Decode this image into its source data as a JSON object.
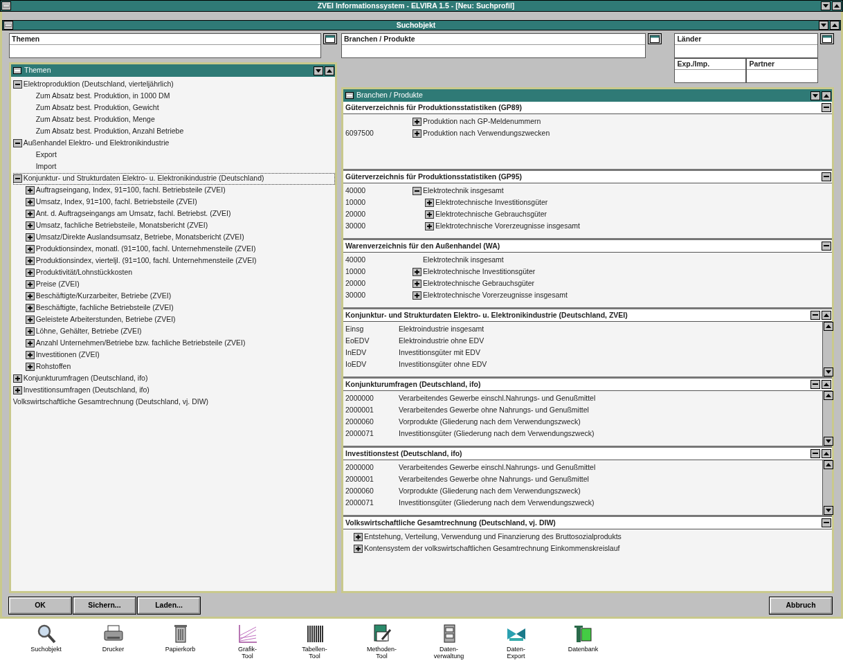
{
  "window": {
    "title": "ZVEI Informationssystem - ELVIRA 1.5 - [Neu: Suchprofil]"
  },
  "subwindow": {
    "title": "Suchobjekt"
  },
  "fields": {
    "themen": {
      "label": "Themen"
    },
    "branchen": {
      "label": "Branchen / Produkte"
    },
    "laender": {
      "label": "Länder"
    },
    "exp_imp": {
      "label": "Exp./Imp."
    },
    "partner": {
      "label": "Partner"
    }
  },
  "themen_panel": {
    "title": "Themen",
    "tree": [
      {
        "label": "Elektroproduktion (Deutschland, vierteljährlich)",
        "expanded": true,
        "selected": false,
        "children": [
          {
            "label": "Zum Absatz best. Produktion, in 1000 DM",
            "selected": false
          },
          {
            "label": "Zum Absatz best. Produktion, Gewicht",
            "selected": false
          },
          {
            "label": "Zum Absatz best. Produktion, Menge",
            "selected": false
          },
          {
            "label": "Zum Absatz best. Produktion, Anzahl Betriebe",
            "selected": false
          }
        ]
      },
      {
        "label": "Außenhandel Elektro- und Elektronikindustrie",
        "expanded": true,
        "selected": false,
        "children": [
          {
            "label": "Export",
            "selected": false
          },
          {
            "label": "Import",
            "selected": false
          }
        ]
      },
      {
        "label": "Konjunktur- und Strukturdaten Elektro- u. Elektronikindustrie (Deutschland)",
        "expanded": true,
        "selected": true,
        "children": [
          {
            "label": "Auftragseingang, Index, 91=100, fachl. Betriebsteile (ZVEI)",
            "expanded": false,
            "selected": false
          },
          {
            "label": "Umsatz, Index, 91=100, fachl. Betriebsteile (ZVEI)",
            "expanded": false,
            "selected": false
          },
          {
            "label": "Ant. d. Auftragseingangs am Umsatz, fachl. Betriebst. (ZVEI)",
            "expanded": false,
            "selected": false
          },
          {
            "label": "Umsatz, fachliche Betriebsteile, Monatsbericht (ZVEI)",
            "expanded": false,
            "selected": false
          },
          {
            "label": "Umsatz/Direkte Auslandsumsatz, Betriebe, Monatsbericht (ZVEI)",
            "expanded": false,
            "selected": false
          },
          {
            "label": "Produktionsindex, monatl. (91=100, fachl. Unternehmensteile (ZVEI)",
            "expanded": false,
            "selected": false
          },
          {
            "label": "Produktionsindex, vierteljl. (91=100, fachl. Unternehmensteile (ZVEI)",
            "expanded": false,
            "selected": false
          },
          {
            "label": "Produktivität/Lohnstückkosten",
            "expanded": false,
            "selected": false
          },
          {
            "label": "Preise (ZVEI)",
            "expanded": false,
            "selected": false
          },
          {
            "label": "Beschäftigte/Kurzarbeiter, Betriebe (ZVEI)",
            "expanded": false,
            "selected": false
          },
          {
            "label": "Beschäftigte, fachliche Betriebsteile (ZVEI)",
            "expanded": false,
            "selected": false
          },
          {
            "label": "Geleistete Arbeiterstunden, Betriebe (ZVEI)",
            "expanded": false,
            "selected": false
          },
          {
            "label": "Löhne, Gehälter, Betriebe (ZVEI)",
            "expanded": false,
            "selected": false
          },
          {
            "label": "Anzahl Unternehmen/Betriebe bzw. fachliche Betriebsteile (ZVEI)",
            "expanded": false,
            "selected": false
          },
          {
            "label": "Investitionen (ZVEI)",
            "expanded": false,
            "selected": false
          },
          {
            "label": "Rohstoffen",
            "expanded": false,
            "selected": false
          }
        ]
      },
      {
        "label": "Konjunkturumfragen (Deutschland, ifo)",
        "expanded": false,
        "selected": false
      },
      {
        "label": "Investitionsumfragen (Deutschland, ifo)",
        "expanded": false,
        "selected": false
      },
      {
        "label": "Volkswirtschaftliche Gesamtrechnung (Deutschland, vj. DIW)",
        "selected": false
      }
    ]
  },
  "branchen_panel": {
    "title": "Branchen / Produkte",
    "sections": [
      {
        "title": "Güterverzeichnis für Produktionsstatistiken (GP89)",
        "kind": "coded-tree",
        "rows": [
          {
            "text": "Produktion nach GP-Meldenummern",
            "expanded": false
          },
          {
            "code": "6097500",
            "text": "Produktion nach Verwendungszwecken",
            "expanded": false
          }
        ]
      },
      {
        "title": "Güterverzeichnis für Produktionsstatistiken (GP95)",
        "kind": "coded-tree",
        "rows": [
          {
            "code": "40000",
            "text": "Elektrotechnik insgesamt",
            "expanded": true,
            "children": [
              {
                "code": "10000",
                "text": "Elektrotechnische Investitionsgüter",
                "expanded": false
              },
              {
                "code": "20000",
                "text": "Elektrotechnische Gebrauchsgüter",
                "expanded": false
              },
              {
                "code": "30000",
                "text": "Elektrotechnische Vorerzeugnisse insgesamt",
                "expanded": false
              }
            ]
          }
        ]
      },
      {
        "title": "Warenverzeichnis für den Außenhandel (WA)",
        "kind": "coded-tree",
        "rows": [
          {
            "code": "40000",
            "text": "Elektrotechnik insgesamt"
          },
          {
            "code": "10000",
            "text": "Elektrotechnische Investitionsgüter",
            "expanded": false
          },
          {
            "code": "20000",
            "text": "Elektrotechnische Gebrauchsgüter",
            "expanded": false
          },
          {
            "code": "30000",
            "text": "Elektrotechnische Vorerzeugnisse insgesamt",
            "expanded": false
          }
        ]
      },
      {
        "title": "Konjunktur- und Strukturdaten Elektro- u. Elektronikindustrie (Deutschland, ZVEI)",
        "kind": "scrolled",
        "rows": [
          {
            "code": "Einsg",
            "text": "Elektroindustrie insgesamt"
          },
          {
            "code": "EoEDV",
            "text": "Elektroindustrie ohne EDV"
          },
          {
            "code": "InEDV",
            "text": "Investitionsgüter mit EDV"
          },
          {
            "code": "IoEDV",
            "text": "Investitionsgüter ohne EDV"
          }
        ]
      },
      {
        "title": "Konjunkturumfragen (Deutschland, ifo)",
        "kind": "scrolled",
        "rows": [
          {
            "code": "2000000",
            "text": "Verarbeitendes Gewerbe einschl.Nahrungs- und Genußmittel"
          },
          {
            "code": "2000001",
            "text": "Verarbeitendes Gewerbe ohne Nahrungs- und Genußmittel"
          },
          {
            "code": "2000060",
            "text": "Vorprodukte (Gliederung nach dem Verwendungszweck)"
          },
          {
            "code": "2000071",
            "text": "Investitionsgüter (Gliederung nach dem Verwendungszweck)"
          }
        ]
      },
      {
        "title": "Investitionstest (Deutschland, ifo)",
        "kind": "scrolled",
        "rows": [
          {
            "code": "2000000",
            "text": "Verarbeitendes Gewerbe einschl.Nahrungs- und Genußmittel"
          },
          {
            "code": "2000001",
            "text": "Verarbeitendes Gewerbe ohne Nahrungs- und Genußmittel"
          },
          {
            "code": "2000060",
            "text": "Vorprodukte (Gliederung nach dem Verwendungszweck)"
          },
          {
            "code": "2000071",
            "text": "Investitionsgüter (Gliederung nach dem Verwendungszweck)"
          }
        ]
      },
      {
        "title": "Volkswirtschaftliche Gesamtrechnung (Deutschland, vj. DIW)",
        "kind": "tree",
        "rows": [
          {
            "text": "Entstehung, Verteilung, Verwendung und Finanzierung des Bruttosozialprodukts",
            "expanded": false
          },
          {
            "text": "Kontensystem der volkswirtschaftlichen Gesamtrechnung Einkommenskreislauf",
            "expanded": false
          }
        ]
      }
    ]
  },
  "buttons_left": [
    "OK",
    "Sichern...",
    "Laden..."
  ],
  "buttons_right": [
    "Abbruch"
  ],
  "toolbar": [
    {
      "label": "Suchobjekt"
    },
    {
      "label": "Drucker"
    },
    {
      "label": "Papierkorb"
    },
    {
      "label": "Grafik-\nTool"
    },
    {
      "label": "Tabellen-\nTool"
    },
    {
      "label": "Methoden-\nTool"
    },
    {
      "label": "Daten-\nverwaltung"
    },
    {
      "label": "Daten-\nExport"
    },
    {
      "label": "Datenbank"
    }
  ]
}
